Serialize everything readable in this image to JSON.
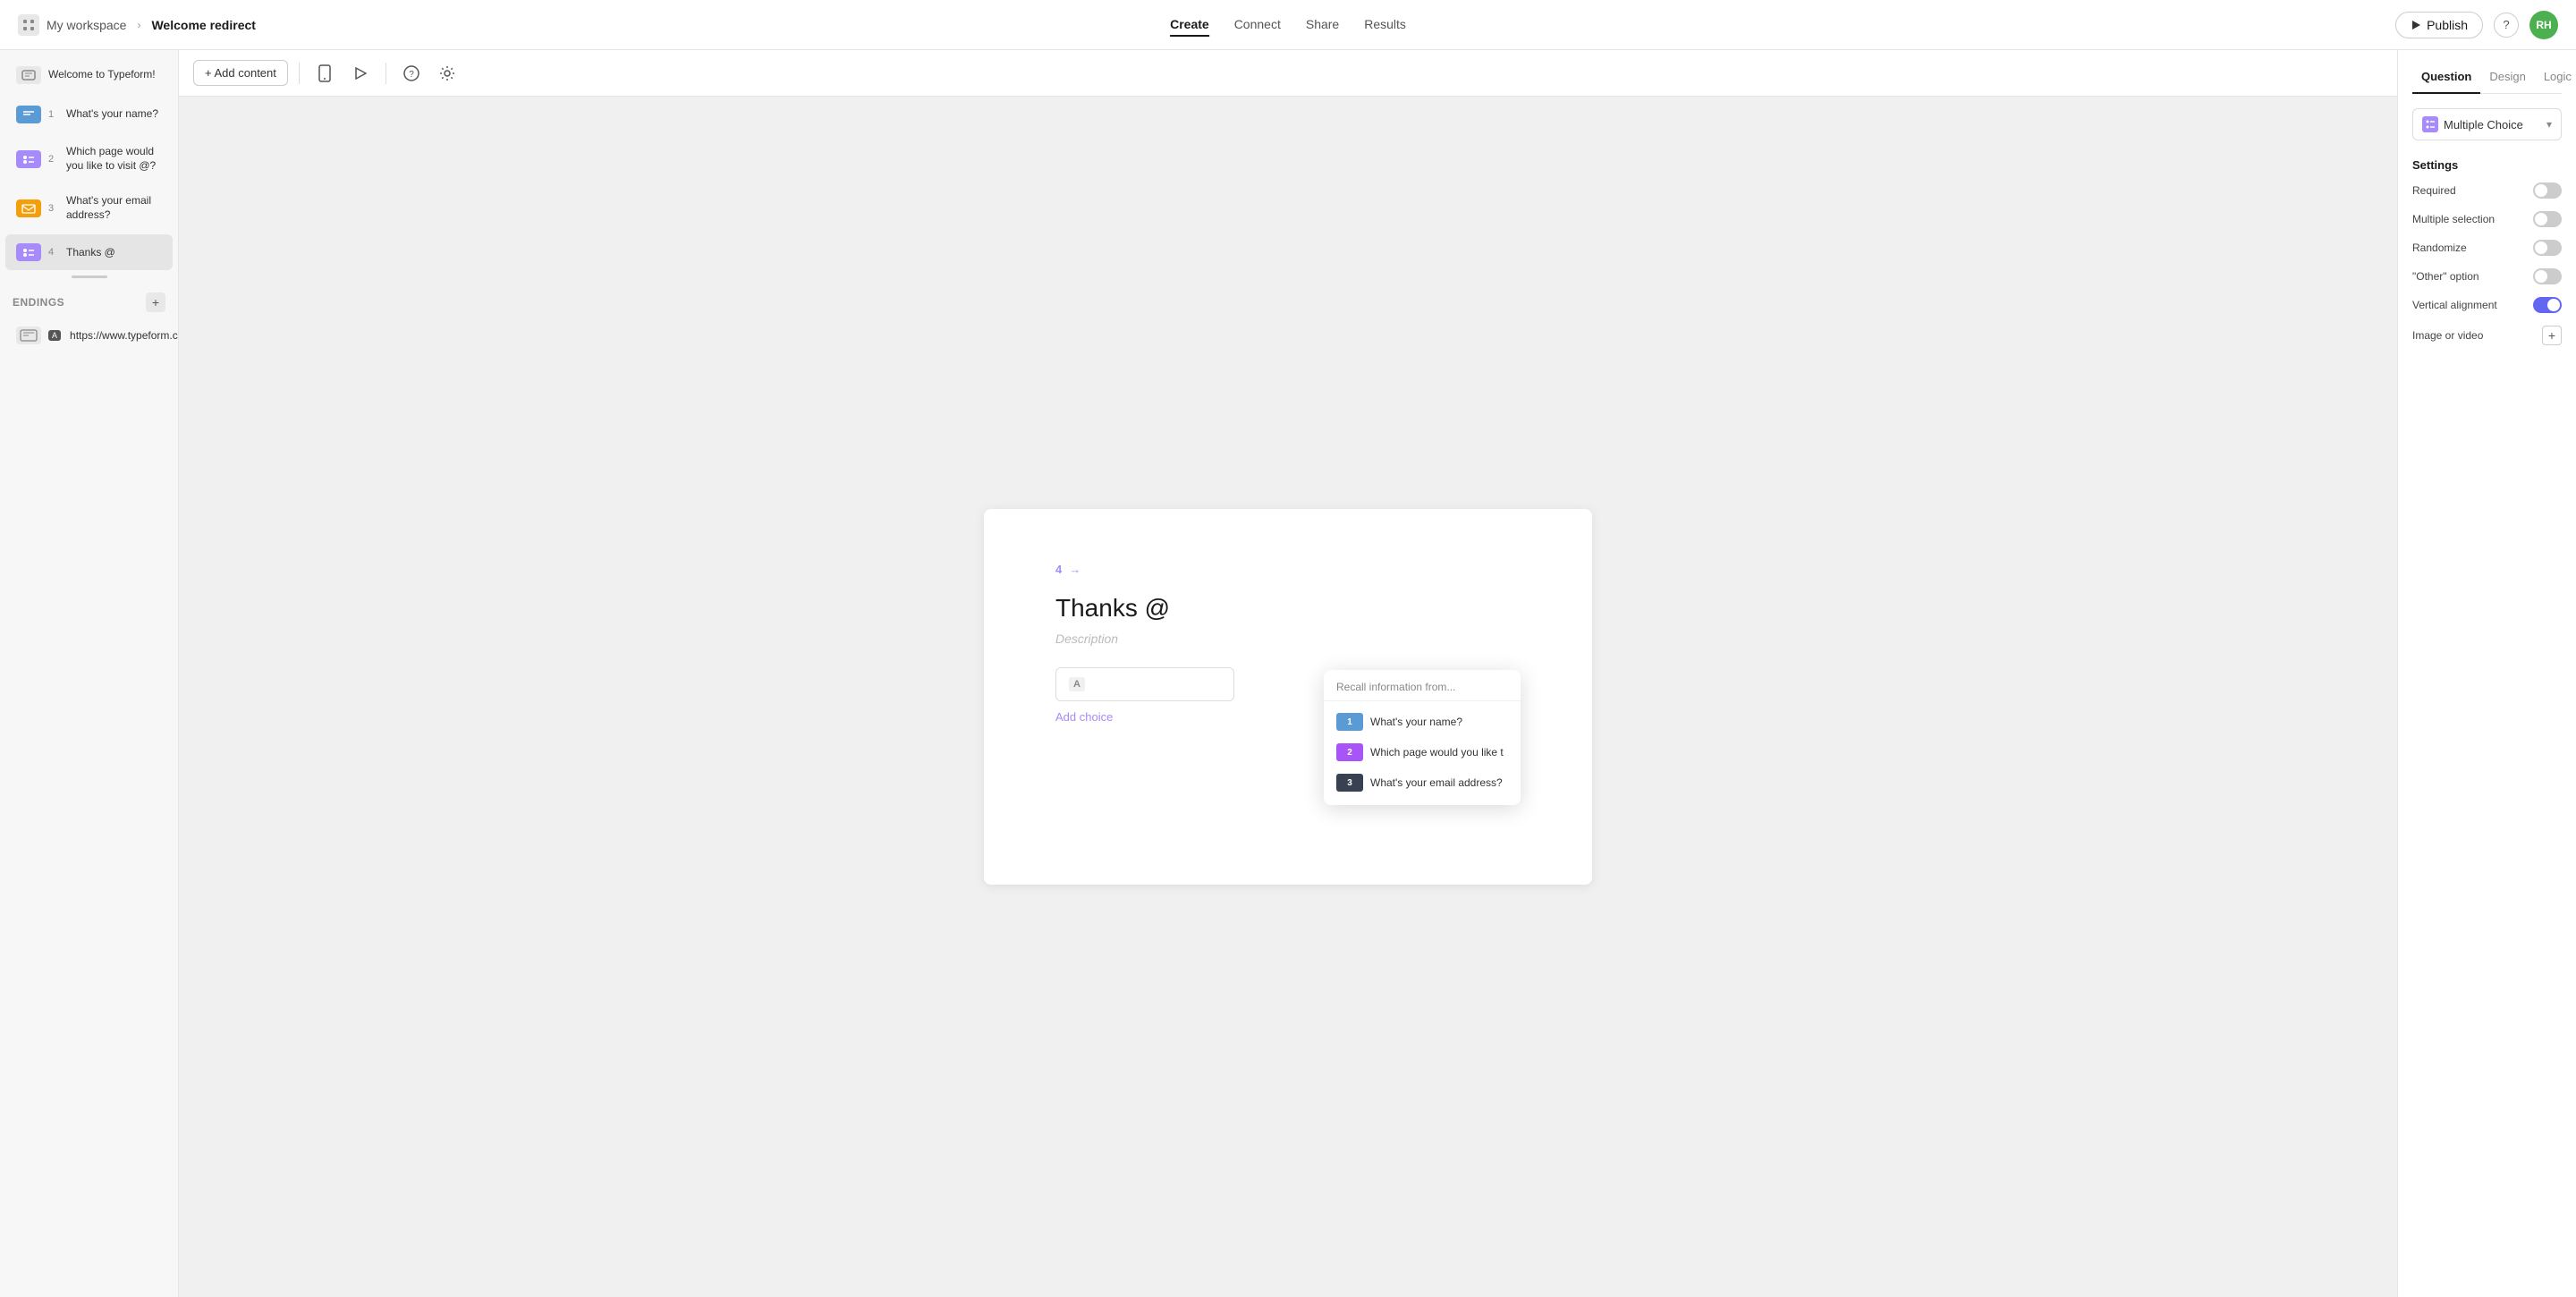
{
  "nav": {
    "workspace_label": "My workspace",
    "chevron": "›",
    "form_title": "Welcome redirect",
    "tabs": [
      "Create",
      "Connect",
      "Share",
      "Results"
    ],
    "active_tab": "Create",
    "publish_label": "Publish",
    "help_label": "?",
    "avatar_initials": "RH"
  },
  "sidebar": {
    "welcome_item": {
      "label": "Welcome to Typeform!"
    },
    "questions": [
      {
        "number": "1",
        "label": "What's your name?"
      },
      {
        "number": "2",
        "label": "Which page would you like to visit @?"
      },
      {
        "number": "3",
        "label": "What's your email address?"
      },
      {
        "number": "4",
        "label": "Thanks @"
      }
    ],
    "endings_title": "Endings",
    "endings_add_label": "+",
    "ending_item": {
      "label": "https://www.typeform.c"
    }
  },
  "toolbar": {
    "add_content_label": "+ Add content"
  },
  "canvas": {
    "step_number": "4",
    "step_arrow": "→",
    "title": "Thanks @",
    "description_placeholder": "Description",
    "choice_key": "A",
    "choice_placeholder": "",
    "add_choice_label": "Add choice"
  },
  "recall_dropdown": {
    "title": "Recall information from...",
    "items": [
      {
        "number": "1",
        "label": "What's your name?",
        "icon_type": "blue"
      },
      {
        "number": "2",
        "label": "Which page would you like t",
        "icon_type": "purple"
      },
      {
        "number": "3",
        "label": "What's your email address?",
        "icon_type": "dark"
      }
    ]
  },
  "right_panel": {
    "tabs": [
      "Question",
      "Design",
      "Logic"
    ],
    "active_tab": "Question",
    "question_type_label": "Multiple Choice",
    "settings_title": "Settings",
    "settings": [
      {
        "label": "Required",
        "on": false
      },
      {
        "label": "Multiple selection",
        "on": false
      },
      {
        "label": "Randomize",
        "on": false
      },
      {
        "label": "\"Other\" option",
        "on": false
      },
      {
        "label": "Vertical alignment",
        "on": true
      }
    ],
    "image_video_label": "Image or video",
    "add_media_label": "+"
  }
}
